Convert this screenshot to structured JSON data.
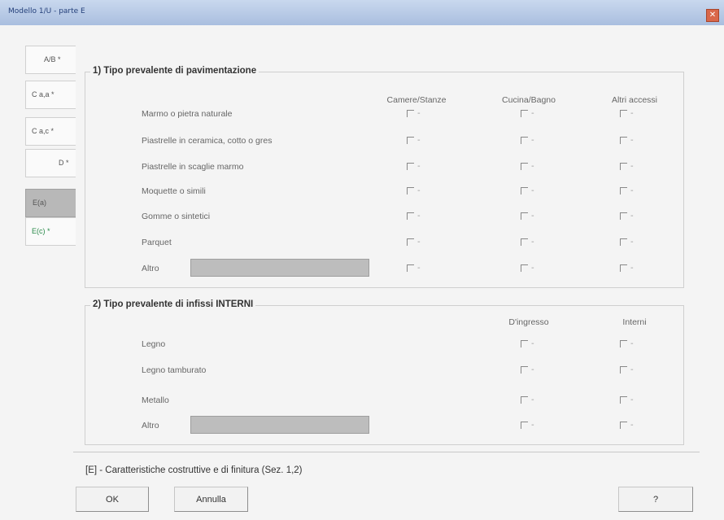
{
  "window": {
    "title": "Modello 1/U - parte E",
    "close_glyph": "✕"
  },
  "tabs": [
    {
      "label": "A/B *"
    },
    {
      "label": "C a,a *"
    },
    {
      "label": "C a,c *"
    },
    {
      "label": "D *"
    },
    {
      "label": "E(a)"
    },
    {
      "label": "E(c) *"
    }
  ],
  "section1": {
    "title": "1) Tipo prevalente di pavimentazione",
    "columns": [
      "Camere/Stanze",
      "Cucina/Bagno",
      "Altri accessi"
    ],
    "rows": [
      "Marmo o pietra naturale",
      "Piastrelle in ceramica, cotto o gres",
      "Piastrelle in scaglie marmo",
      "Moquette o simili",
      "Gomme o sintetici",
      "Parquet",
      "Altro"
    ],
    "altro_value": "",
    "checkbox_mark": "-"
  },
  "section2": {
    "title": "2) Tipo prevalente di infissi INTERNI",
    "columns": [
      "D'ingresso",
      "Interni"
    ],
    "rows": [
      "Legno",
      "Legno tamburato",
      "Metallo",
      "Altro"
    ],
    "altro_value": "",
    "checkbox_mark": "-"
  },
  "footer": {
    "label": "[E] - Caratteristiche costruttive e di finitura (Sez. 1,2)"
  },
  "buttons": {
    "ok": "OK",
    "cancel": "Annulla",
    "help": "?"
  }
}
